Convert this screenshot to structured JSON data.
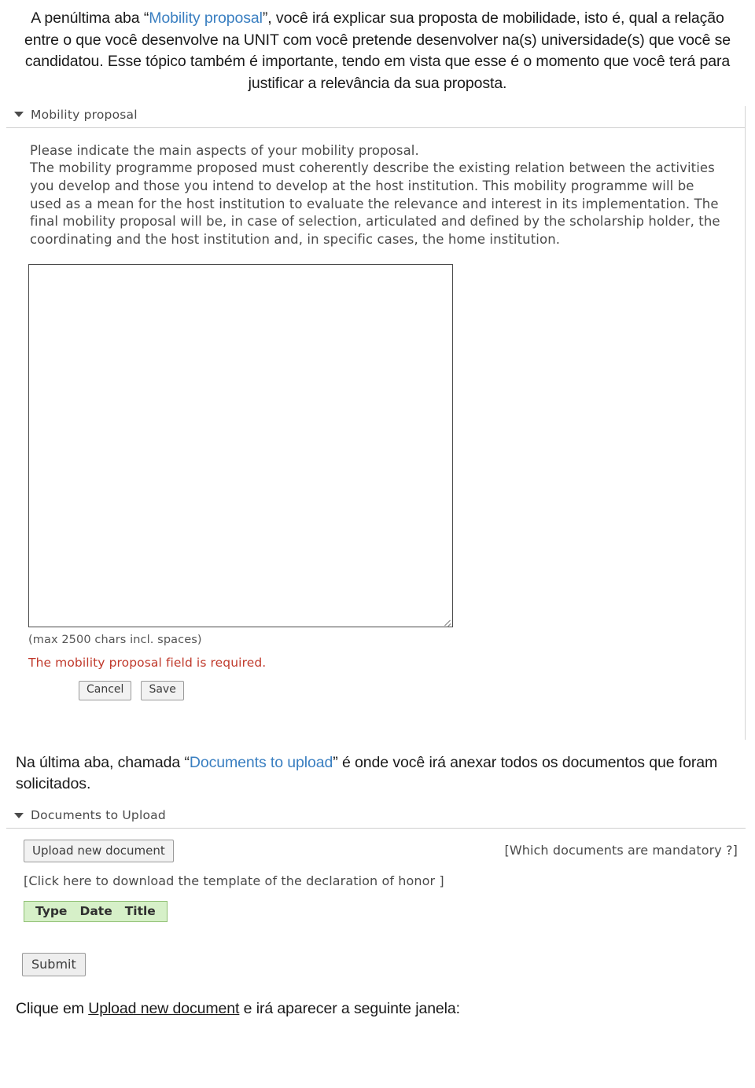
{
  "document": {
    "intro_paragraph": {
      "part1": "A penúltima aba “",
      "tab_name": "Mobility proposal",
      "part2": "”, você irá explicar sua proposta de mobilidade, isto é, qual a relação entre o que você desenvolve na UNIT com você pretende desenvolver na(s) universidade(s) que você se candidatou. Esse tópico também é importante, tendo em vista que esse é o momento que você terá para justificar a relevância da sua proposta."
    },
    "mobility_screenshot": {
      "section_title": "Mobility proposal",
      "instruction_line1": "Please indicate the main aspects of your mobility proposal.",
      "instruction_body": "The mobility programme proposed must coherently describe the existing relation between the activities you develop and those you intend to develop at the host institution. This mobility programme will be used as a mean for the host institution to evaluate the relevance and interest in its implementation. The final mobility proposal will be, in case of selection, articulated and defined by the scholarship holder, the coordinating and the host institution and, in specific cases, the home institution.",
      "textarea_value": "",
      "max_chars_note": "(max 2500 chars incl. spaces)",
      "error_message": "The mobility proposal field is required.",
      "cancel_label": "Cancel",
      "save_label": "Save"
    },
    "middle_paragraph": {
      "part1": "Na última aba, chamada “",
      "tab_name": "Documents to upload",
      "part2": "” é onde você irá anexar todos os documentos que foram solicitados."
    },
    "upload_screenshot": {
      "section_title": "Documents to Upload",
      "upload_button_label": "Upload new document",
      "mandatory_note": "[Which documents are mandatory ?]",
      "template_link": "[Click here to download the template of the declaration of honor ]",
      "table_headers": [
        "Type",
        "Date",
        "Title"
      ],
      "submit_label": "Submit"
    },
    "closing_paragraph": {
      "part1": "Clique em ",
      "link_text": "Upload new document",
      "part2": " e irá aparecer a seguinte janela:"
    },
    "colors": {
      "link_blue": "#3a7fc1",
      "error_red": "#c0392b",
      "green_header_bg": "#d6f0c8"
    }
  }
}
